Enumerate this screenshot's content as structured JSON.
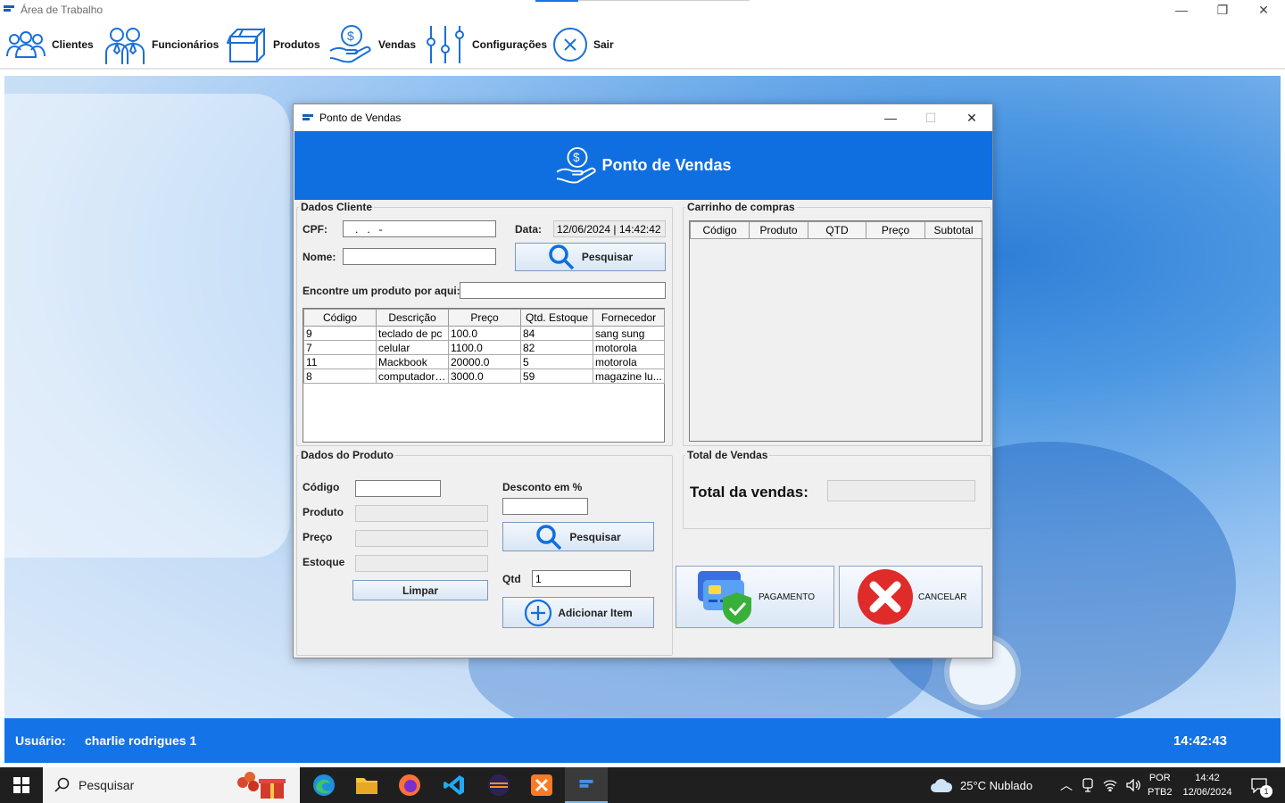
{
  "window": {
    "title": "Área de Trabalho",
    "controls": {
      "minimize": "—",
      "restore": "❐",
      "close": "✕"
    }
  },
  "menu": [
    {
      "label": "Clientes",
      "icon": "users-icon"
    },
    {
      "label": "Funcionários",
      "icon": "employees-icon"
    },
    {
      "label": "Produtos",
      "icon": "box-icon"
    },
    {
      "label": "Vendas",
      "icon": "money-hand-icon"
    },
    {
      "label": "Configurações",
      "icon": "sliders-icon"
    },
    {
      "label": "Sair",
      "icon": "close-circle-icon"
    }
  ],
  "dialog": {
    "title": "Ponto de Vendas",
    "header": "Ponto de Vendas",
    "controls": {
      "minimize": "—",
      "maximize": "☐",
      "close": "✕"
    },
    "cliente": {
      "legend": "Dados Cliente",
      "cpf_label": "CPF:",
      "cpf_value": "   .   .   -",
      "data_label": "Data:",
      "data_value": "12/06/2024 | 14:42:42",
      "nome_label": "Nome:",
      "nome_value": "",
      "pesquisar": "Pesquisar",
      "find_label": "Encontre um produto por aqui:",
      "find_value": ""
    },
    "produtos_table": {
      "columns": [
        "Código",
        "Descrição",
        "Preço",
        "Qtd. Estoque",
        "Fornecedor"
      ],
      "rows": [
        [
          "9",
          "teclado de pc",
          "100.0",
          "84",
          "sang sung"
        ],
        [
          "7",
          "celular",
          "1100.0",
          "82",
          "motorola"
        ],
        [
          "11",
          "Mackbook",
          "20000.0",
          "5",
          "motorola"
        ],
        [
          "8",
          "computador ...",
          "3000.0",
          "59",
          "magazine lu..."
        ]
      ]
    },
    "carrinho": {
      "legend": "Carrinho de compras",
      "columns": [
        "Código",
        "Produto",
        "QTD",
        "Preço",
        "Subtotal"
      ]
    },
    "produto": {
      "legend": "Dados do Produto",
      "codigo_label": "Código",
      "produto_label": "Produto",
      "preco_label": "Preço",
      "estoque_label": "Estoque",
      "limpar": "Limpar",
      "desconto_label": "Desconto em %",
      "pesquisar": "Pesquisar",
      "qtd_label": "Qtd",
      "qtd_value": "1",
      "adicionar": "Adicionar Item"
    },
    "total": {
      "legend": "Total de Vendas",
      "label": "Total da vendas:",
      "value": ""
    },
    "pagamento": "PAGAMENTO",
    "cancelar": "CANCELAR"
  },
  "status": {
    "user_label": "Usuário:",
    "user_name": "charlie rodrigues 1",
    "time": "14:42:43"
  },
  "taskbar": {
    "search_placeholder": "Pesquisar",
    "weather": "25°C  Nublado",
    "lang_top": "POR",
    "lang_bottom": "PTB2",
    "clock_time": "14:42",
    "clock_date": "12/06/2024",
    "notif_count": "1"
  },
  "colors": {
    "accent": "#0f6fe0",
    "statusbar": "#1473e6",
    "taskbar": "#1f1f1f"
  }
}
